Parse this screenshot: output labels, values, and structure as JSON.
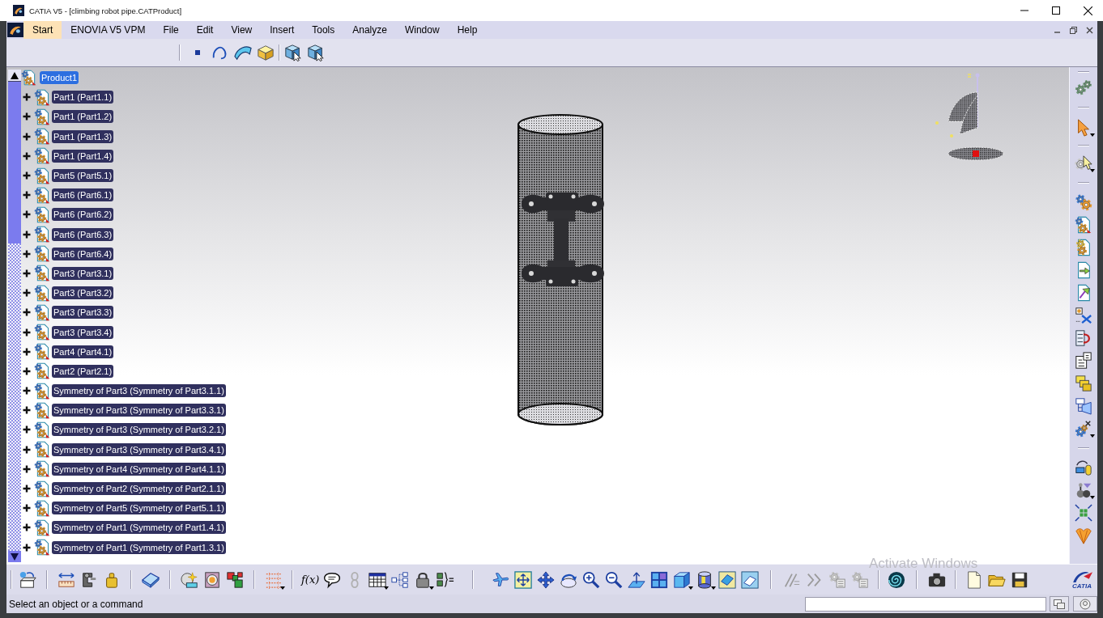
{
  "window": {
    "title": "CATIA V5 - [climbing robot pipe.CATProduct]"
  },
  "menu_bar": {
    "items": [
      {
        "label": "Start",
        "selected": true
      },
      {
        "label": "ENOVIA V5 VPM",
        "selected": false
      },
      {
        "label": "File",
        "selected": false
      },
      {
        "label": "Edit",
        "selected": false
      },
      {
        "label": "View",
        "selected": false
      },
      {
        "label": "Insert",
        "selected": false
      },
      {
        "label": "Tools",
        "selected": false
      },
      {
        "label": "Analyze",
        "selected": false
      },
      {
        "label": "Window",
        "selected": false
      },
      {
        "label": "Help",
        "selected": false
      }
    ]
  },
  "specification_tree": {
    "root": {
      "label": "Product1",
      "selected": true,
      "children": [
        {
          "label": "Part1 (Part1.1)",
          "selected": false,
          "expanded": false
        },
        {
          "label": "Part1 (Part1.2)",
          "selected": false,
          "expanded": false
        },
        {
          "label": "Part1 (Part1.3)",
          "selected": false,
          "expanded": false
        },
        {
          "label": "Part1 (Part1.4)",
          "selected": false,
          "expanded": false
        },
        {
          "label": "Part5 (Part5.1)",
          "selected": false,
          "expanded": false
        },
        {
          "label": "Part6 (Part6.1)",
          "selected": false,
          "expanded": false
        },
        {
          "label": "Part6 (Part6.2)",
          "selected": false,
          "expanded": false
        },
        {
          "label": "Part6 (Part6.3)",
          "selected": false,
          "expanded": false
        },
        {
          "label": "Part6 (Part6.4)",
          "selected": false,
          "expanded": false
        },
        {
          "label": "Part3 (Part3.1)",
          "selected": false,
          "expanded": false
        },
        {
          "label": "Part3 (Part3.2)",
          "selected": false,
          "expanded": false
        },
        {
          "label": "Part3 (Part3.3)",
          "selected": false,
          "expanded": false
        },
        {
          "label": "Part3 (Part3.4)",
          "selected": false,
          "expanded": false
        },
        {
          "label": "Part4 (Part4.1)",
          "selected": false,
          "expanded": false
        },
        {
          "label": "Part2 (Part2.1)",
          "selected": false,
          "expanded": false
        },
        {
          "label": "Symmetry of Part3 (Symmetry of Part3.1.1)",
          "selected": false,
          "expanded": false
        },
        {
          "label": "Symmetry of Part3 (Symmetry of Part3.3.1)",
          "selected": false,
          "expanded": false
        },
        {
          "label": "Symmetry of Part3 (Symmetry of Part3.2.1)",
          "selected": false,
          "expanded": false
        },
        {
          "label": "Symmetry of Part3 (Symmetry of Part3.4.1)",
          "selected": false,
          "expanded": false
        },
        {
          "label": "Symmetry of Part4 (Symmetry of Part4.1.1)",
          "selected": false,
          "expanded": false
        },
        {
          "label": "Symmetry of Part2 (Symmetry of Part2.1.1)",
          "selected": false,
          "expanded": false
        },
        {
          "label": "Symmetry of Part5 (Symmetry of Part5.1.1)",
          "selected": false,
          "expanded": false
        },
        {
          "label": "Symmetry of Part1 (Symmetry of Part1.4.1)",
          "selected": false,
          "expanded": false
        },
        {
          "label": "Symmetry of Part1 (Symmetry of Part1.3.1)",
          "selected": false,
          "expanded": false
        }
      ]
    }
  },
  "bottom_toolbar": {
    "formula_label": "f(x)"
  },
  "logo": {
    "text": "CATIA"
  },
  "status_bar": {
    "message": "Select an object or a command"
  },
  "system_notice": "Activate Windows"
}
